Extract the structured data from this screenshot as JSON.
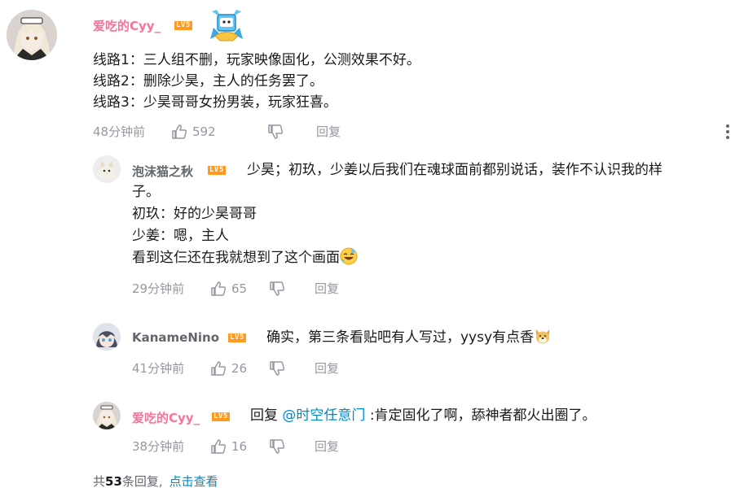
{
  "main_comment": {
    "username": "爱吃的Cyy_",
    "level": "LV5",
    "lines": [
      "线路1：三人组不删，玩家映像固化，公测效果不好。",
      "线路2：删除少昊，主人的任务罢了。",
      "线路3：少昊哥哥女扮男装，玩家狂喜。"
    ],
    "time": "48分钟前",
    "likes": "592",
    "reply_label": "回复"
  },
  "replies": [
    {
      "username": "泡沫猫之秋",
      "level": "LV5",
      "line1": "少昊；初玖，少姜以后我们在魂球面前都别说话，装作不认识我的样",
      "line2": "子。",
      "line3": "初玖：好的少昊哥哥",
      "line4": "少姜：嗯，主人",
      "line5": "看到这仨还在我就想到了这个画面",
      "emoji": "sweat-laugh-emoji",
      "time": "29分钟前",
      "likes": "65",
      "reply_label": "回复"
    },
    {
      "username": "KanameNino",
      "level": "LV5",
      "text": "确实，第三条看贴吧有人写过，yysy有点香",
      "emoji": "dog-face-emoji",
      "time": "41分钟前",
      "likes": "26",
      "reply_label": "回复"
    },
    {
      "username": "爱吃的Cyy_",
      "level": "LV5",
      "prefix": "回复",
      "mention": "@时空任意门",
      "text": ":肯定固化了啊，舔神者都火出圈了。",
      "time": "38分钟前",
      "likes": "16",
      "reply_label": "回复"
    }
  ],
  "footer": {
    "prefix": "共",
    "count": "53",
    "suffix": "条回复,",
    "link": "点击查看"
  },
  "colors": {
    "username_pink": "#fb7299",
    "username_gray": "#61666d",
    "link_blue": "#008ac5",
    "meta_gray": "#9499a0",
    "level_orange": "#ff9a1f"
  }
}
